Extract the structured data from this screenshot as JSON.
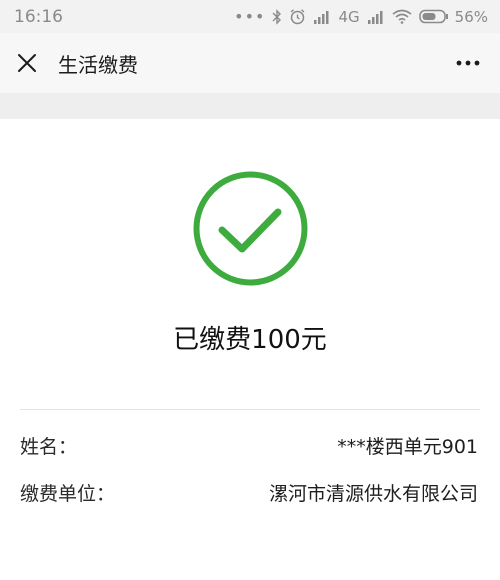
{
  "status_bar": {
    "time": "16:16",
    "network": "4G",
    "battery_percent": "56%",
    "icons": [
      "more-dots-icon",
      "bluetooth-icon",
      "alarm-icon",
      "signal-icon",
      "network-4g-icon",
      "signal-icon",
      "wifi-icon",
      "battery-icon"
    ]
  },
  "nav": {
    "title": "生活缴费",
    "close_icon": "close-icon",
    "more_icon": "more-icon"
  },
  "result": {
    "status_icon": "success-check-icon",
    "message": "已缴费100元",
    "accent_color": "#3dab3d"
  },
  "details": [
    {
      "label": "姓名：",
      "value": "***楼西单元901"
    },
    {
      "label": "缴费单位：",
      "value": "漯河市清源供水有限公司"
    }
  ]
}
